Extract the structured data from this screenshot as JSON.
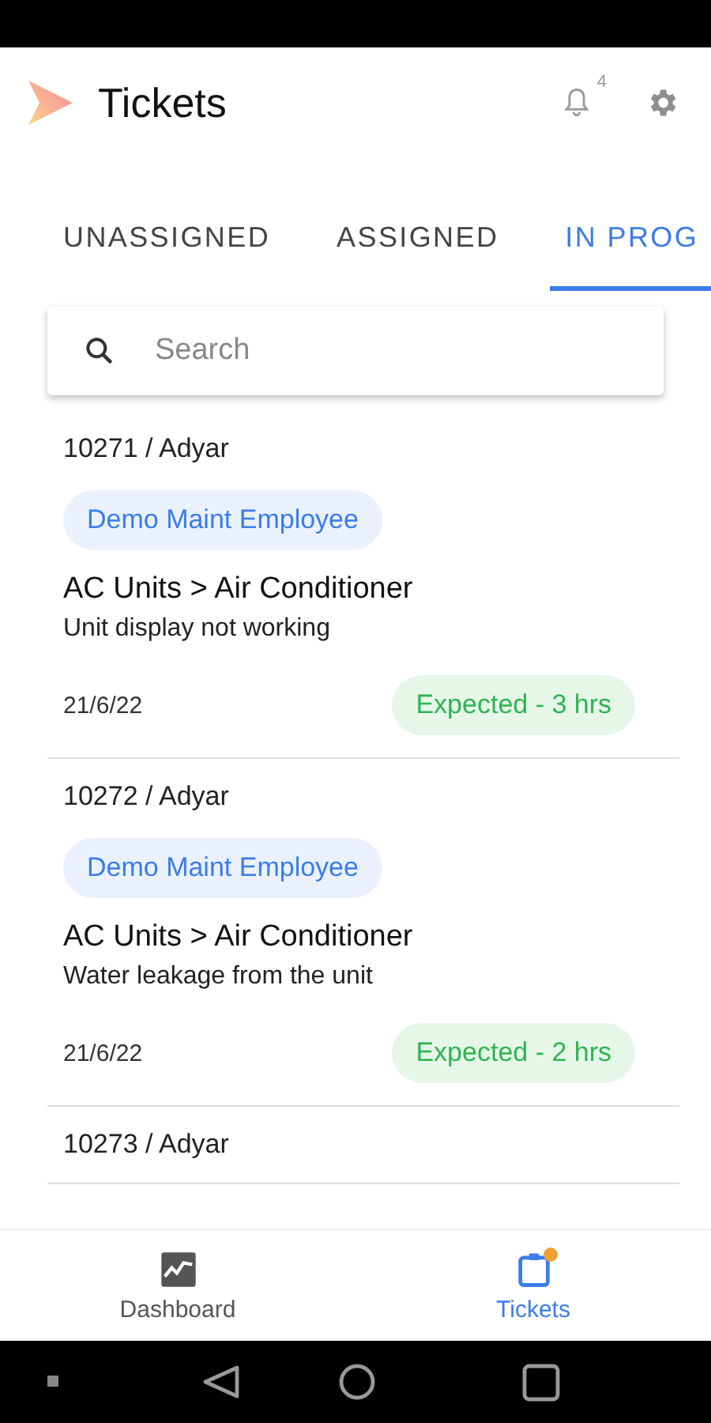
{
  "header": {
    "title": "Tickets",
    "notification_count": "4"
  },
  "tabs": [
    {
      "label": "UNASSIGNED",
      "selected": false
    },
    {
      "label": "ASSIGNED",
      "selected": false
    },
    {
      "label": "IN PROG",
      "selected": true
    }
  ],
  "search": {
    "placeholder": "Search"
  },
  "tickets": [
    {
      "id_location": "10271 / Adyar",
      "assignee": "Demo Maint Employee",
      "category": "AC Units > Air Conditioner",
      "description": "Unit display not working",
      "date": "21/6/22",
      "eta": "Expected - 3 hrs"
    },
    {
      "id_location": "10272 / Adyar",
      "assignee": "Demo Maint Employee",
      "category": "AC Units > Air Conditioner",
      "description": "Water leakage from the unit",
      "date": "21/6/22",
      "eta": "Expected - 2 hrs"
    },
    {
      "id_location": "10273 / Adyar"
    }
  ],
  "bottom_nav": [
    {
      "label": "Dashboard",
      "kind": "dashboard",
      "selected": false,
      "dot": false
    },
    {
      "label": "Tickets",
      "kind": "tickets",
      "selected": true,
      "dot": true
    }
  ]
}
